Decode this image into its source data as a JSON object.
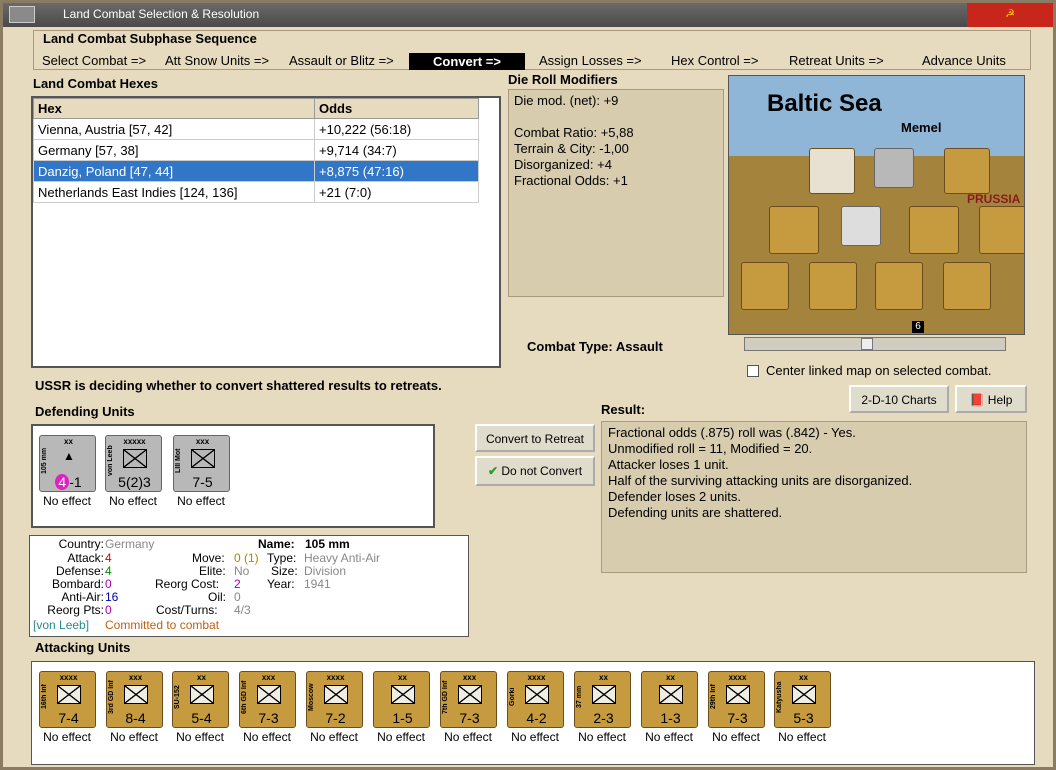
{
  "window": {
    "title": "Land Combat Selection & Resolution"
  },
  "subphase": {
    "title": "Land Combat Subphase Sequence",
    "steps": [
      "Select Combat =>",
      "Att Snow Units =>",
      "Assault or Blitz =>",
      "Convert =>",
      "Assign Losses =>",
      "Hex Control =>",
      "Retreat Units =>",
      "Advance Units"
    ],
    "active_index": 3
  },
  "hexes": {
    "title": "Land Combat Hexes",
    "headers": [
      "Hex",
      "Odds"
    ],
    "rows": [
      {
        "hex": "Vienna, Austria [57, 42]",
        "odds": "+10,222 (56:18)"
      },
      {
        "hex": "Germany [57, 38]",
        "odds": "+9,714 (34:7)"
      },
      {
        "hex": "Danzig, Poland [47, 44]",
        "odds": "+8,875 (47:16)"
      },
      {
        "hex": "Netherlands East Indies [124, 136]",
        "odds": "+21 (7:0)"
      }
    ],
    "selected_index": 2
  },
  "die_roll": {
    "title": "Die Roll Modifiers",
    "lines": [
      "Die mod. (net): +9",
      "",
      "Combat Ratio: +5,88",
      "Terrain & City: -1,00",
      "Disorganized: +4",
      "Fractional Odds: +1"
    ]
  },
  "map": {
    "sea_label": "Baltic Sea",
    "city": "Memel",
    "region": "PRUSSIA",
    "hex_marker": "6"
  },
  "combat_type": {
    "label": "Combat Type:",
    "value": "Assault"
  },
  "center_map": {
    "label": "Center linked map on selected combat.",
    "checked": false
  },
  "status_message": "USSR is deciding whether to convert shattered results to retreats.",
  "defending": {
    "title": "Defending Units",
    "units": [
      {
        "side_label": "105 mm",
        "size": "xx",
        "value_a": "4",
        "value_b": "-1",
        "effect": "No effect",
        "color": "#b8b8b8"
      },
      {
        "side_label": "von Leeb",
        "size": "xxxxx",
        "value_a": "5(2)3",
        "value_b": "",
        "effect": "No effect",
        "color": "#b8b8b8"
      },
      {
        "side_label": "LIII Mot",
        "size": "xxx",
        "value_a": "7-5",
        "value_b": "",
        "effect": "No effect",
        "color": "#b8b8b8"
      }
    ]
  },
  "buttons": {
    "convert": "Convert to Retreat",
    "no_convert": "Do not Convert",
    "charts": "2-D-10 Charts",
    "help": "Help"
  },
  "result": {
    "title": "Result:",
    "lines": [
      "Fractional odds (.875) roll was (.842)  - Yes.",
      "Unmodified roll = 11, Modified = 20.",
      "Attacker loses 1 unit.",
      "Half of the surviving attacking units are disorganized.",
      "Defender loses 2 units.",
      "Defending units are shattered."
    ]
  },
  "unit_info": {
    "country_k": "Country:",
    "country_v": "Germany",
    "attack_k": "Attack:",
    "attack_v": "4",
    "defense_k": "Defense:",
    "defense_v": "4",
    "bombard_k": "Bombard:",
    "bombard_v": "0",
    "antiair_k": "Anti-Air:",
    "antiair_v": "16",
    "reorg_k": "Reorg Pts:",
    "reorg_v": "0",
    "name_k": "Name:",
    "name_v": "105 mm",
    "move_k": "Move:",
    "move_v": "0 (1)",
    "type_k": "Type:",
    "type_v": "Heavy Anti-Air",
    "elite_k": "Elite:",
    "elite_v": "No",
    "size_k": "Size:",
    "size_v": "Division",
    "reorgcost_k": "Reorg Cost:",
    "reorgcost_v": "2",
    "year_k": "Year:",
    "year_v": "1941",
    "oil_k": "Oil:",
    "oil_v": "0",
    "cost_k": "Cost/Turns:",
    "cost_v": "4/3",
    "hq": "[von Leeb]",
    "status": "Committed to combat"
  },
  "attacking": {
    "title": "Attacking Units",
    "units": [
      {
        "side_label": "16th Inf",
        "size": "xxxx",
        "value": "7-4",
        "effect": "No effect"
      },
      {
        "side_label": "3rd GD Inf",
        "size": "xxx",
        "value": "8-4",
        "effect": "No effect"
      },
      {
        "side_label": "SU-152",
        "size": "xx",
        "value": "5-4",
        "effect": "No effect"
      },
      {
        "side_label": "6th GD Inf",
        "size": "xxx",
        "value": "7-3",
        "effect": "No effect"
      },
      {
        "side_label": "Moscow",
        "size": "xxxx",
        "value": "7-2",
        "effect": "No effect"
      },
      {
        "side_label": "",
        "size": "xx",
        "value": "1-5",
        "effect": "No effect"
      },
      {
        "side_label": "7th GD Inf",
        "size": "xxx",
        "value": "7-3",
        "effect": "No effect"
      },
      {
        "side_label": "Gorki",
        "size": "xxxx",
        "value": "4-2",
        "effect": "No effect"
      },
      {
        "side_label": "37 mm",
        "size": "xx",
        "value": "2-3",
        "effect": "No effect"
      },
      {
        "side_label": "",
        "size": "xx",
        "value": "1-3",
        "effect": "No effect"
      },
      {
        "side_label": "29th Inf",
        "size": "xxxx",
        "value": "7-3",
        "effect": "No effect"
      },
      {
        "side_label": "Katyusha",
        "size": "xx",
        "value": "5-3",
        "effect": "No effect"
      }
    ]
  },
  "colors": {
    "soviet_counter": "#c69a3e",
    "german_counter": "#b8b8b8",
    "selected_row": "#3276c8",
    "panel_bg": "#e6dbbf"
  }
}
